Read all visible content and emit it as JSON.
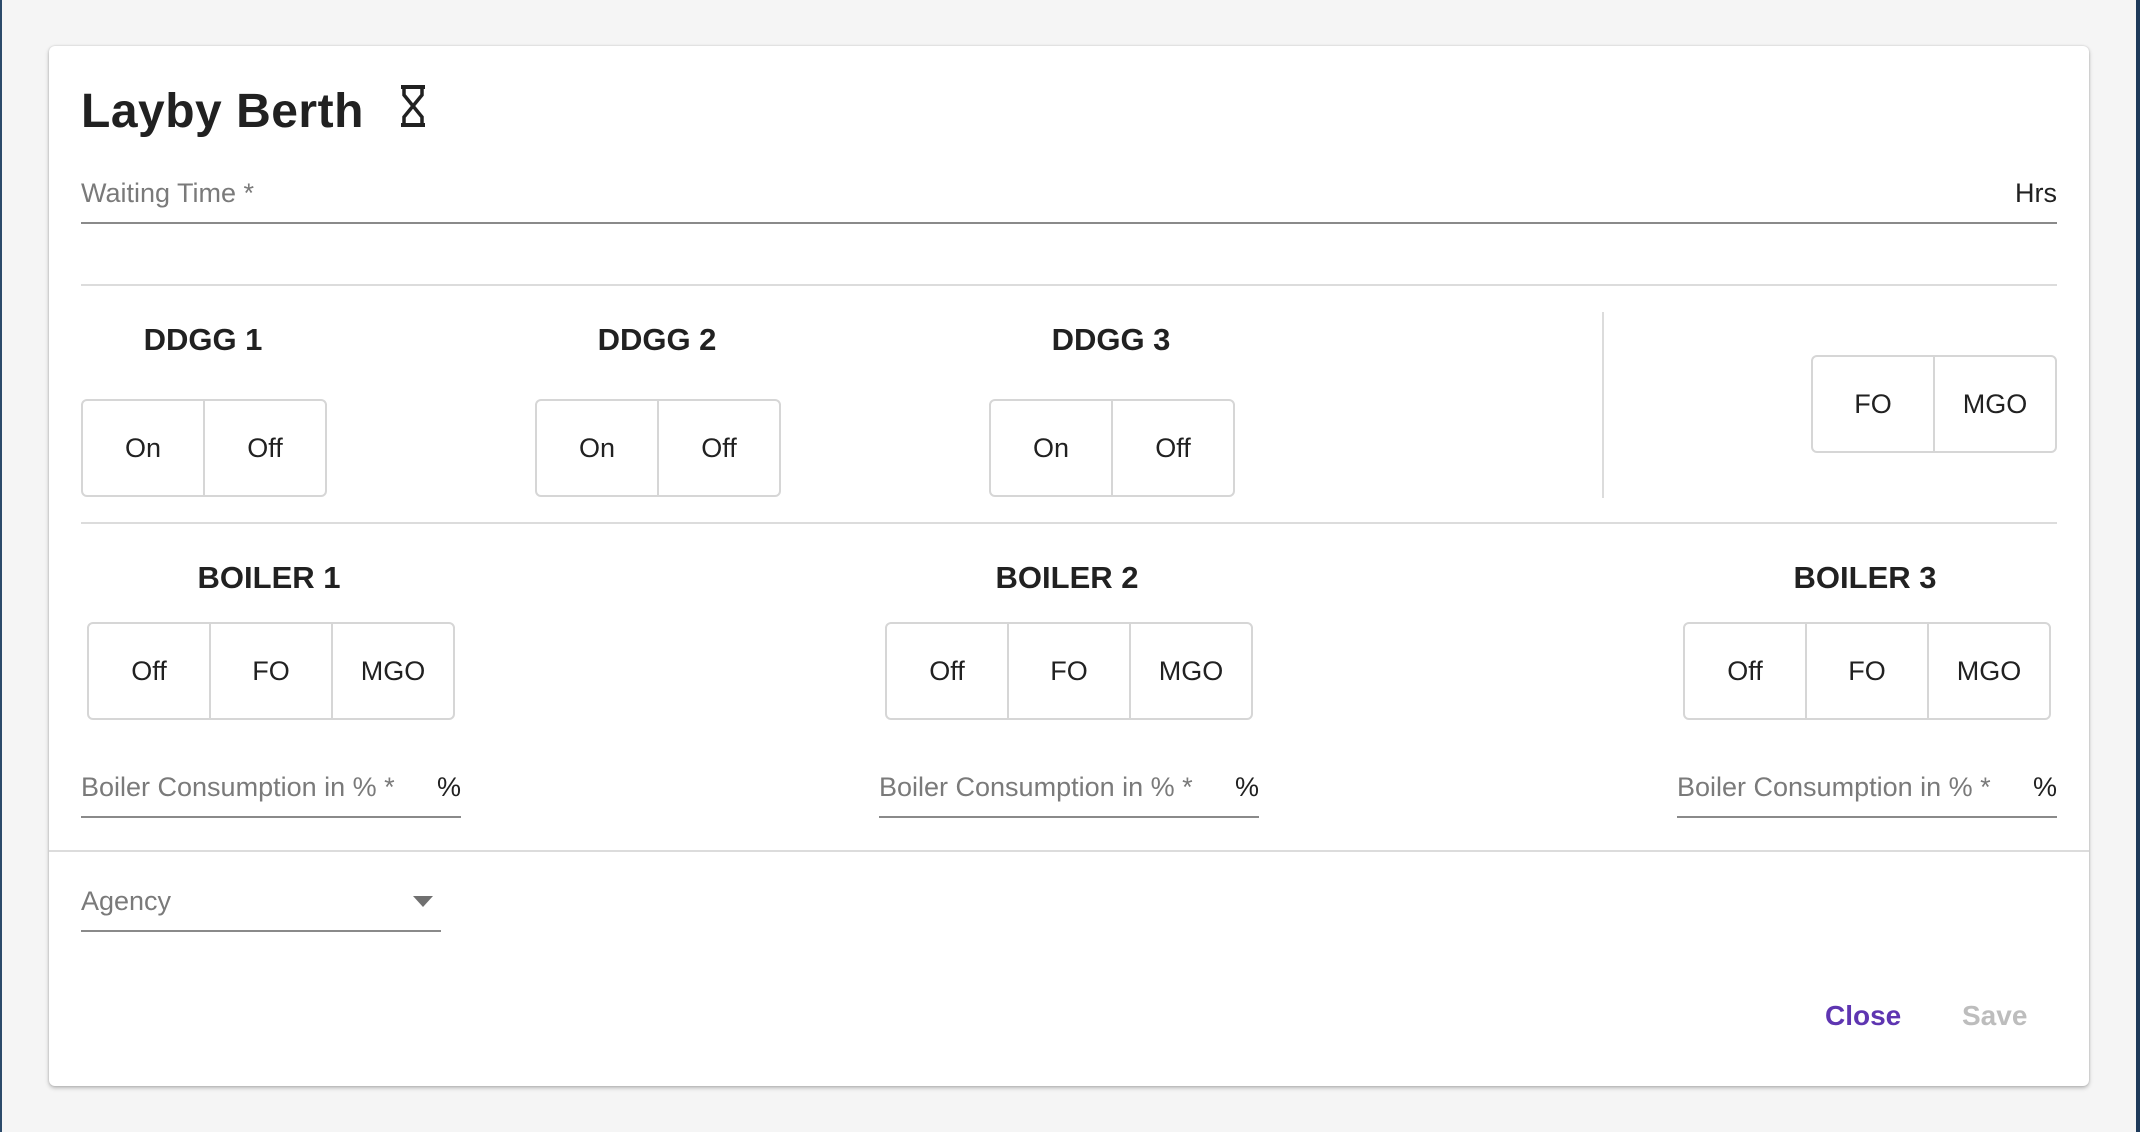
{
  "dialog": {
    "title": "Layby Berth",
    "title_icon": "hourglass-icon"
  },
  "waiting_time": {
    "label": "Waiting Time *",
    "value": "",
    "suffix": "Hrs"
  },
  "ddgg": [
    {
      "title": "DDGG 1",
      "options": [
        "On",
        "Off"
      ]
    },
    {
      "title": "DDGG 2",
      "options": [
        "On",
        "Off"
      ]
    },
    {
      "title": "DDGG 3",
      "options": [
        "On",
        "Off"
      ]
    }
  ],
  "fuel_toggle": {
    "options": [
      "FO",
      "MGO"
    ]
  },
  "boilers": [
    {
      "title": "BOILER 1",
      "options": [
        "Off",
        "FO",
        "MGO"
      ],
      "consumption_label": "Boiler Consumption in % *",
      "consumption_suffix": "%"
    },
    {
      "title": "BOILER 2",
      "options": [
        "Off",
        "FO",
        "MGO"
      ],
      "consumption_label": "Boiler Consumption in % *",
      "consumption_suffix": "%"
    },
    {
      "title": "BOILER 3",
      "options": [
        "Off",
        "FO",
        "MGO"
      ],
      "consumption_label": "Boiler Consumption in % *",
      "consumption_suffix": "%"
    }
  ],
  "agency": {
    "label": "Agency",
    "selected": ""
  },
  "actions": {
    "close_label": "Close",
    "save_label": "Save",
    "close_color": "#5e35b1",
    "save_color": "#bdbdbd"
  }
}
